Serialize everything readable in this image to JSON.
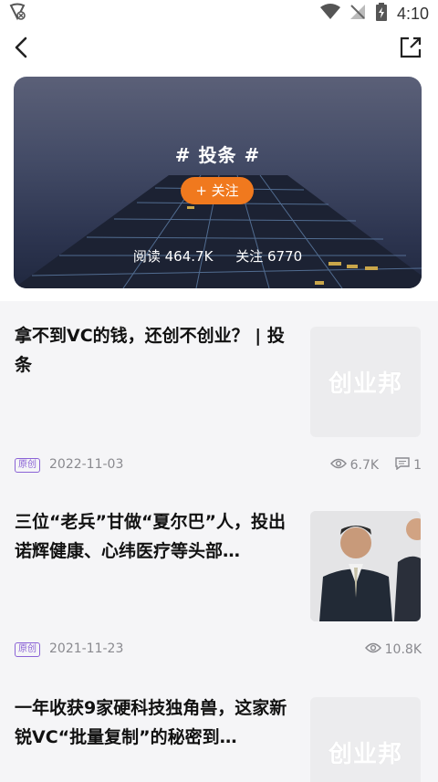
{
  "status": {
    "time": "4:10"
  },
  "hero": {
    "title": "# 投条 #",
    "follow_label": "+ 关注",
    "read_label": "阅读 464.7K",
    "follow_count_label": "关注 6770"
  },
  "articles": [
    {
      "title": "拿不到VC的钱，还创不创业？ | 投条",
      "tag": "原创",
      "date": "2022-11-03",
      "views": "6.7K",
      "comments": "1",
      "thumb_logo": "创业邦"
    },
    {
      "title": "三位“老兵”甘做“夏尔巴”人，投出诺辉健康、心纬医疗等头部…",
      "tag": "原创",
      "date": "2021-11-23",
      "views": "10.8K"
    },
    {
      "title": "一年收获9家硬科技独角兽，这家新锐VC“批量复制”的秘密到…",
      "thumb_logo": "创业邦"
    }
  ],
  "colors": {
    "accent": "#f0791e",
    "tag": "#8b63d6"
  }
}
